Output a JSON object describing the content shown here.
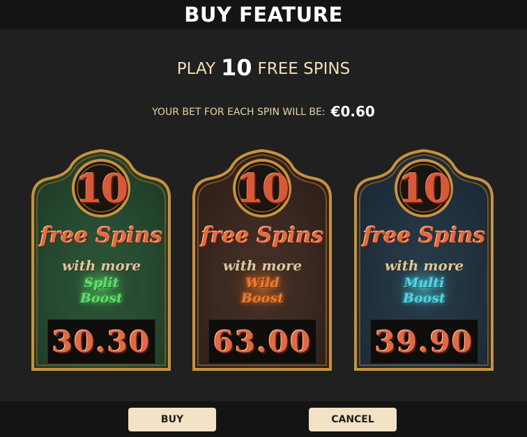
{
  "header": {
    "title": "BUY FEATURE"
  },
  "offer": {
    "prefix": "PLAY",
    "count": "10",
    "suffix": "FREE SPINS"
  },
  "bet": {
    "label": "YOUR BET FOR EACH SPIN WILL BE:",
    "amount": "€0.60"
  },
  "cards": [
    {
      "spins": "10",
      "free_spins_label": "free Spins",
      "with_label": "with more",
      "boost_line1": "Split",
      "boost_line2": "Boost",
      "price": "30.30",
      "theme": {
        "bg": "#2f5a3c",
        "bg_dark": "#1f3e29",
        "glow": "#5ee06a"
      }
    },
    {
      "spins": "10",
      "free_spins_label": "free Spins",
      "with_label": "with more",
      "boost_line1": "Wild",
      "boost_line2": "Boost",
      "price": "63.00",
      "theme": {
        "bg": "#4a342c",
        "bg_dark": "#2f201a",
        "glow": "#f07a2a"
      }
    },
    {
      "spins": "10",
      "free_spins_label": "free Spins",
      "with_label": "with more",
      "boost_line1": "Multi",
      "boost_line2": "Boost",
      "price": "39.90",
      "theme": {
        "bg": "#2b3f4e",
        "bg_dark": "#1b2a36",
        "glow": "#4fd6e6"
      }
    }
  ],
  "buttons": {
    "buy": "BUY",
    "cancel": "CANCEL"
  }
}
